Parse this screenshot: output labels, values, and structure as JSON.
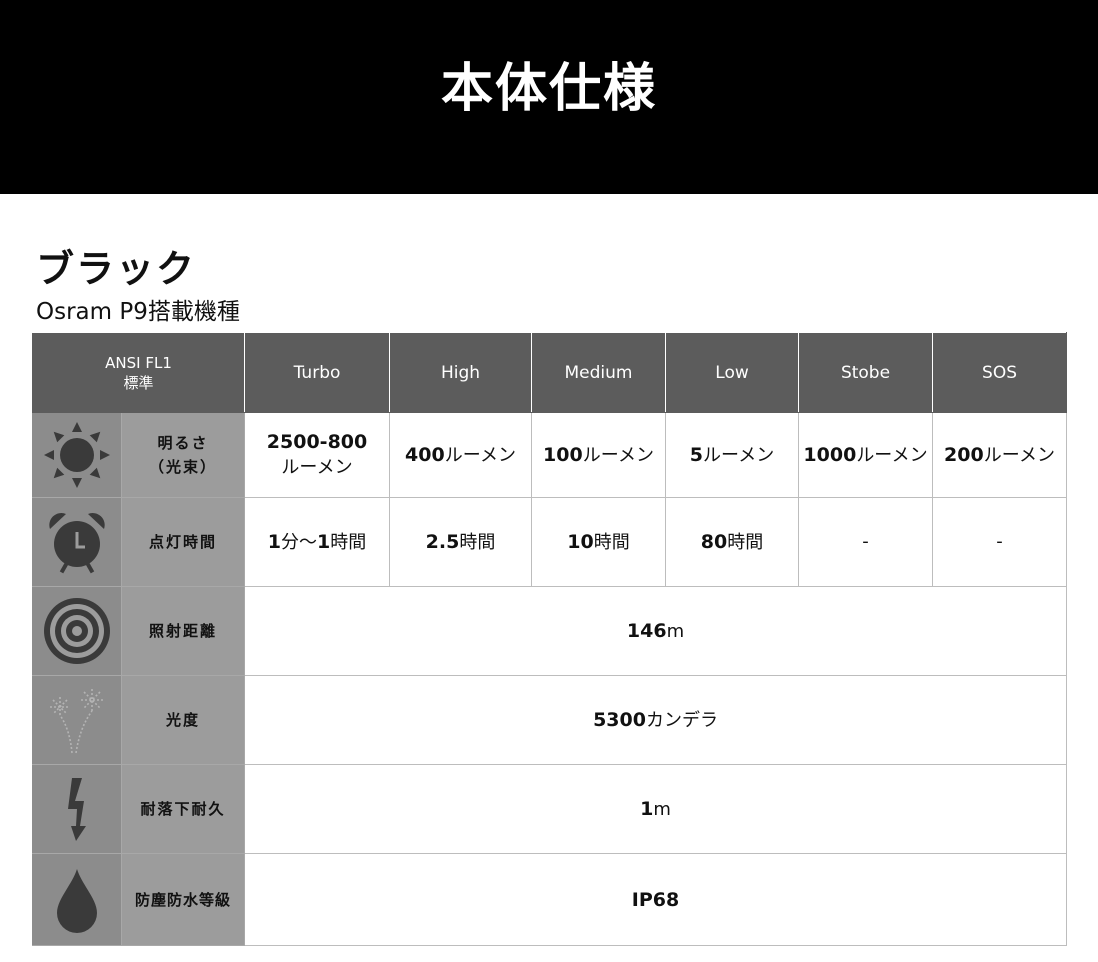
{
  "banner": {
    "title": "本体仕様"
  },
  "product": {
    "color": "ブラック",
    "model": "Osram P9搭載機種"
  },
  "table": {
    "header": {
      "corner_line1": "ANSI FL1",
      "corner_line2": "標準",
      "modes": [
        "Turbo",
        "High",
        "Medium",
        "Low",
        "Stobe",
        "SOS"
      ]
    },
    "rows": {
      "brightness": {
        "label_line1": "明るさ",
        "label_line2": "（光束）",
        "icon": "sun-icon",
        "turbo": {
          "num": "2500-800",
          "unit": "ルーメン"
        },
        "high": {
          "num": "400",
          "unit": "ルーメン"
        },
        "medium": {
          "num": "100",
          "unit": "ルーメン"
        },
        "low": {
          "num": "5",
          "unit": "ルーメン"
        },
        "stobe": {
          "num": "1000",
          "unit": "ルーメン"
        },
        "sos": {
          "num": "200",
          "unit": "ルーメン"
        }
      },
      "runtime": {
        "label": "点灯時間",
        "icon": "alarm-clock-icon",
        "turbo": {
          "num1": "1",
          "text1": "分〜",
          "num2": "1",
          "text2": "時間"
        },
        "high": {
          "num": "2.5",
          "unit": "時間"
        },
        "medium": {
          "num": "10",
          "unit": "時間"
        },
        "low": {
          "num": "80",
          "unit": "時間"
        },
        "stobe": "-",
        "sos": "-"
      },
      "distance": {
        "label": "照射距離",
        "icon": "target-icon",
        "num": "146",
        "unit": "m"
      },
      "intensity": {
        "label": "光度",
        "icon": "fireworks-icon",
        "num": "5300",
        "unit": "カンデラ"
      },
      "impact": {
        "label": "耐落下耐久",
        "icon": "lightning-icon",
        "num": "1",
        "unit": "m"
      },
      "waterproof": {
        "label": "防塵防水等級",
        "icon": "water-drop-icon",
        "value": "IP68"
      }
    }
  }
}
